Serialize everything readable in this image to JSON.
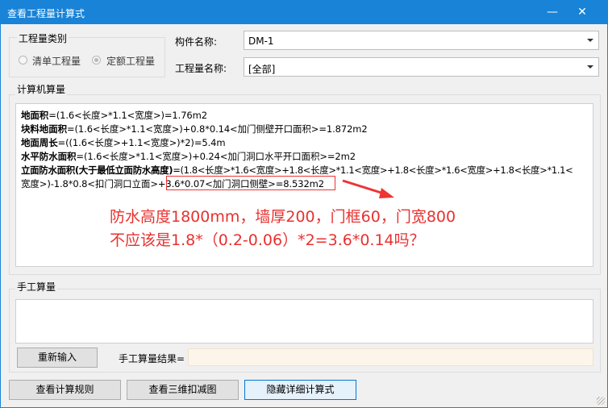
{
  "window": {
    "title": "查看工程量计算式",
    "minimize_glyph": "—",
    "close_glyph": "✕"
  },
  "category_group": {
    "label": "工程量类别",
    "options": [
      {
        "label": "清单工程量",
        "checked": false
      },
      {
        "label": "定额工程量",
        "checked": true
      }
    ]
  },
  "fields": {
    "component_label": "构件名称:",
    "component_value": "DM-1",
    "quantity_label": "工程量名称:",
    "quantity_value": "[全部]"
  },
  "computer_calc": {
    "label": "计算机算量",
    "lines": [
      {
        "bold": "地面积",
        "rest": "=(1.6<长度>*1.1<宽度>)=1.76m2"
      },
      {
        "bold": "块料地面积",
        "rest": "=(1.6<长度>*1.1<宽度>)+0.8*0.14<加门侧壁开口面积>=1.872m2"
      },
      {
        "bold": "地面周长",
        "rest": "=((1.6<长度>+1.1<宽度>)*2)=5.4m"
      },
      {
        "bold": "水平防水面积",
        "rest": "=(1.6<长度>*1.1<宽度>)+0.24<加门洞口水平开口面积>=2m2"
      },
      {
        "bold": "立面防水面积(大于最低立面防水高度)",
        "rest": "=(1.8<长度>*1.6<宽度>+1.8<长度>*1.1<宽度>+1.8<长度>*1.6<宽度>+1.8<长度>*1.1<"
      },
      {
        "bold": "",
        "rest": "宽度>)-1.8*0.8<扣门洞口立面>+3.6*0.07<加门洞口侧壁>=8.532m2"
      }
    ],
    "annotation_line1": "防水高度1800mm，墙厚200，门框60，门宽800",
    "annotation_line2": "不应该是1.8*（0.2-0.06）*2=3.6*0.14吗？",
    "annotation_color": "#e8312f"
  },
  "manual_calc": {
    "label": "手工算量",
    "reenter_button": "重新输入",
    "result_label": "手工算量结果="
  },
  "footer": {
    "rules_button": "查看计算规则",
    "view3d_button": "查看三维扣减图",
    "hide_button": "隐藏详细计算式"
  }
}
